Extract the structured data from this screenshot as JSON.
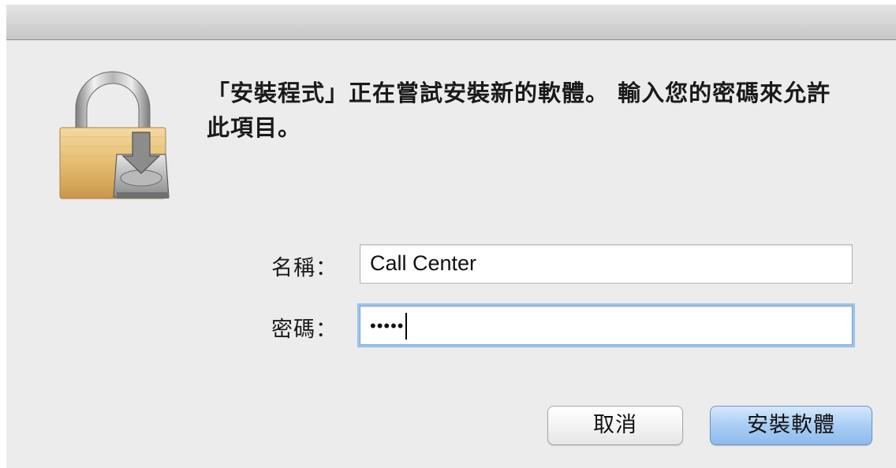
{
  "dialog": {
    "message": "「安裝程式」正在嘗試安裝新的軟體。 輸入您的密碼來允許此項目。"
  },
  "form": {
    "name_label": "名稱：",
    "name_value": "Call Center",
    "password_label": "密碼：",
    "password_mask": "•••••"
  },
  "buttons": {
    "cancel_label": "取消",
    "install_label": "安裝軟體"
  },
  "icons": {
    "main": "lock-with-installer-disk-icon"
  },
  "colors": {
    "focus_ring": "#9cc3ec",
    "default_button": "#a9cdf4"
  }
}
